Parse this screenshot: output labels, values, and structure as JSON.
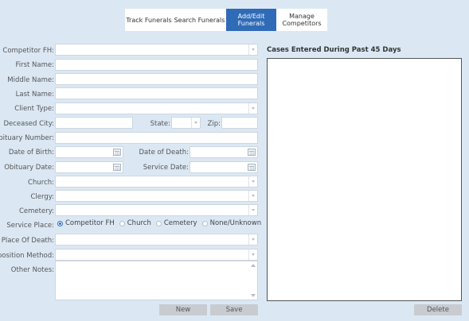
{
  "tabs": [
    {
      "label": "Track Funerals",
      "active": false
    },
    {
      "label": "Search Funerals",
      "active": false
    },
    {
      "label": "Add/Edit\nFunerals",
      "active": true
    },
    {
      "label": "Manage\nCompetitors",
      "active": false
    }
  ],
  "form": {
    "competitor_fh": {
      "label": "Competitor FH:",
      "value": ""
    },
    "first_name": {
      "label": "First Name:",
      "value": ""
    },
    "middle_name": {
      "label": "Middle Name:",
      "value": ""
    },
    "last_name": {
      "label": "Last Name:",
      "value": ""
    },
    "client_type": {
      "label": "Client Type:",
      "value": ""
    },
    "deceased_city": {
      "label": "Deceased City:",
      "value": ""
    },
    "state": {
      "label": "State:",
      "value": ""
    },
    "zip": {
      "label": "Zip:",
      "value": ""
    },
    "obituary_number": {
      "label": "Obituary Number:",
      "value": ""
    },
    "date_of_birth": {
      "label": "Date of Birth:",
      "value": ""
    },
    "date_of_death": {
      "label": "Date of Death:",
      "value": ""
    },
    "obituary_date": {
      "label": "Obituary Date:",
      "value": ""
    },
    "service_date": {
      "label": "Service Date:",
      "value": ""
    },
    "church": {
      "label": "Church:",
      "value": ""
    },
    "clergy": {
      "label": "Clergy:",
      "value": ""
    },
    "cemetery": {
      "label": "Cemetery:",
      "value": ""
    },
    "service_place": {
      "label": "Service Place:",
      "options": [
        "Competitor FH",
        "Church",
        "Cemetery",
        "None/Unknown"
      ],
      "selected": "Competitor FH"
    },
    "place_of_death": {
      "label": "Place Of Death:",
      "value": ""
    },
    "disposition_method": {
      "label": "isposition Method:",
      "value": ""
    },
    "other_notes": {
      "label": "Other Notes:",
      "value": ""
    }
  },
  "buttons": {
    "new": "New",
    "save": "Save",
    "delete": "Delete"
  },
  "cases_panel": {
    "title": "Cases Entered During Past 45 Days"
  },
  "colors": {
    "background": "#dbe8f4",
    "accent": "#2f6bb7"
  }
}
